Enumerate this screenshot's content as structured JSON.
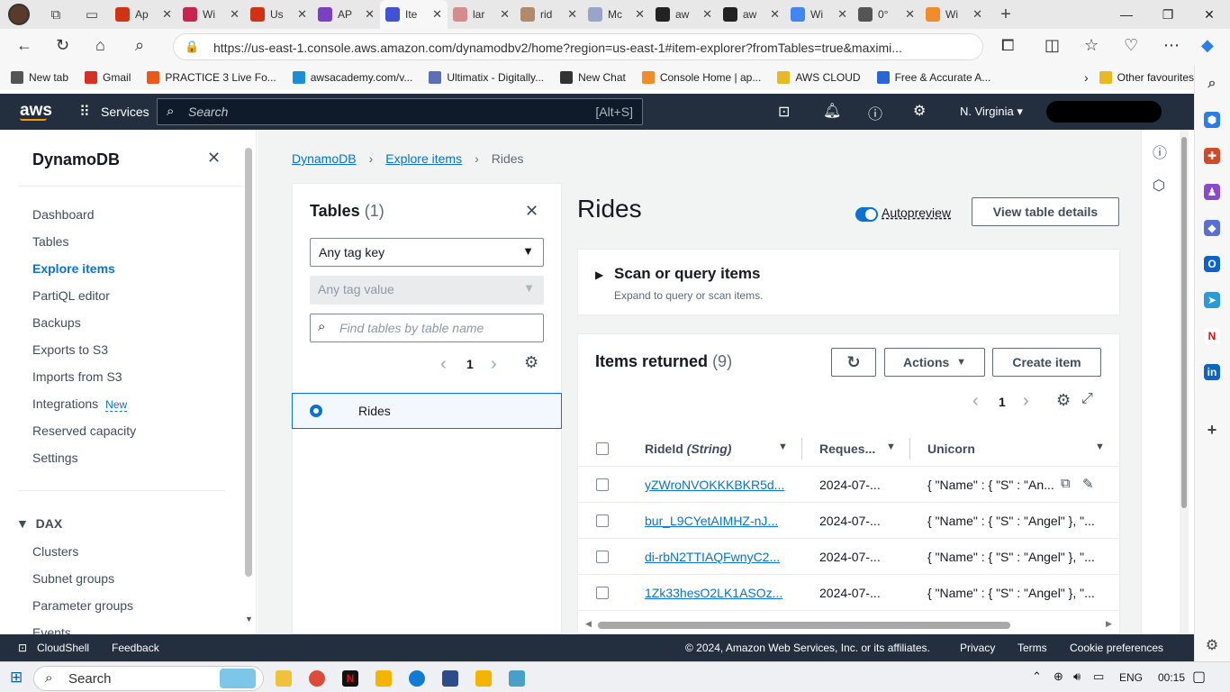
{
  "browser": {
    "tabs": [
      {
        "label": "Ap",
        "icon": "red-warning-icon",
        "color": "#d13212"
      },
      {
        "label": "Wi",
        "icon": "w-icon",
        "color": "#c7254e"
      },
      {
        "label": "Us",
        "icon": "red-doc-icon",
        "color": "#d13212"
      },
      {
        "label": "AP",
        "icon": "api-icon",
        "color": "#7b3fc4"
      },
      {
        "label": "Ite",
        "icon": "dynamodb-icon",
        "color": "#4053d6"
      },
      {
        "label": "lar",
        "icon": "page-icon",
        "color": "#d48c8c"
      },
      {
        "label": "rid",
        "icon": "page-icon",
        "color": "#b08a6a"
      },
      {
        "label": "Mc",
        "icon": "page-icon",
        "color": "#9aa3c8"
      },
      {
        "label": "aw",
        "icon": "github-icon",
        "color": "#222222"
      },
      {
        "label": "aw",
        "icon": "github-icon",
        "color": "#222222"
      },
      {
        "label": "Wi",
        "icon": "google-icon",
        "color": "#4285f4"
      },
      {
        "label": "0°",
        "icon": "doc-icon",
        "color": "#555555"
      },
      {
        "label": "Wi",
        "icon": "orange-icon",
        "color": "#f28c28"
      }
    ],
    "url": "https://us-east-1.console.aws.amazon.com/dynamodbv2/home?region=us-east-1#item-explorer?fromTables=true&maximi...",
    "bookmarks": [
      {
        "label": "New tab",
        "color": "#555555"
      },
      {
        "label": "Gmail",
        "color": "#d93025"
      },
      {
        "label": "PRACTICE 3 Live Fo...",
        "color": "#e8591a"
      },
      {
        "label": "awsacademy.com/v...",
        "color": "#1a8fd6"
      },
      {
        "label": "Ultimatix - Digitally...",
        "color": "#5a6fb5"
      },
      {
        "label": "New Chat",
        "color": "#333333"
      },
      {
        "label": "Console Home | ap...",
        "color": "#f28c28"
      },
      {
        "label": "AWS CLOUD",
        "color": "#e8b923"
      },
      {
        "label": "Free & Accurate A...",
        "color": "#2a66d6"
      }
    ],
    "other_favourites": "Other favourites"
  },
  "aws_header": {
    "logo": "aws",
    "services": "Services",
    "search_placeholder": "Search",
    "search_shortcut": "[Alt+S]",
    "region": "N. Virginia"
  },
  "sidebar": {
    "title": "DynamoDB",
    "items": [
      {
        "label": "Dashboard"
      },
      {
        "label": "Tables"
      },
      {
        "label": "Explore items"
      },
      {
        "label": "PartiQL editor"
      },
      {
        "label": "Backups"
      },
      {
        "label": "Exports to S3"
      },
      {
        "label": "Imports from S3"
      },
      {
        "label": "Integrations"
      },
      {
        "label": "Reserved capacity"
      },
      {
        "label": "Settings"
      }
    ],
    "new_badge": "New",
    "dax_title": "DAX",
    "dax_items": [
      {
        "label": "Clusters"
      },
      {
        "label": "Subnet groups"
      },
      {
        "label": "Parameter groups"
      },
      {
        "label": "Events"
      }
    ]
  },
  "breadcrumb": {
    "items": [
      "DynamoDB",
      "Explore items",
      "Rides"
    ]
  },
  "tables_panel": {
    "title": "Tables",
    "count": "(1)",
    "tag_key": "Any tag key",
    "tag_value": "Any tag value",
    "search_placeholder": "Find tables by table name",
    "page": "1",
    "selected_table": "Rides"
  },
  "content": {
    "title": "Rides",
    "autopreview": "Autopreview",
    "view_details": "View table details",
    "scan_title": "Scan or query items",
    "scan_sub": "Expand to query or scan items.",
    "items_title": "Items returned",
    "items_count": "(9)",
    "actions": "Actions",
    "create_item": "Create item",
    "page": "1",
    "columns": [
      "RideId",
      "(String)",
      "Reques...",
      "Unicorn"
    ],
    "rows": [
      {
        "id": "yZWroNVOKKKBKR5d...",
        "time": "2024-07-...",
        "unicorn": "{ \"Name\" : { \"S\" : \"An..."
      },
      {
        "id": "bur_L9CYetAIMHZ-nJ...",
        "time": "2024-07-...",
        "unicorn": "{ \"Name\" : { \"S\" : \"Angel\" }, \"..."
      },
      {
        "id": "di-rbN2TTIAQFwnyC2...",
        "time": "2024-07-...",
        "unicorn": "{ \"Name\" : { \"S\" : \"Angel\" }, \"..."
      },
      {
        "id": "1Zk33hesO2LK1ASOz...",
        "time": "2024-07-...",
        "unicorn": "{ \"Name\" : { \"S\" : \"Angel\" }, \"..."
      }
    ]
  },
  "footer": {
    "cloudshell": "CloudShell",
    "feedback": "Feedback",
    "copyright": "© 2024, Amazon Web Services, Inc. or its affiliates.",
    "privacy": "Privacy",
    "terms": "Terms",
    "cookies": "Cookie preferences"
  },
  "taskbar": {
    "search": "Search",
    "lang": "ENG",
    "time": "00:15"
  }
}
